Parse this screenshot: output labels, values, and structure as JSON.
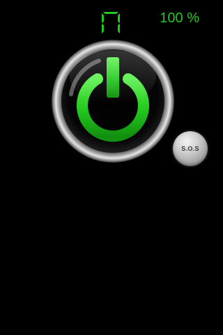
{
  "status": {
    "level_indicator": "7-segment-digit-icon",
    "battery_text": "100 %"
  },
  "power_button": {
    "icon": "power-icon",
    "state": "on",
    "color": "#22c81e"
  },
  "sos_button": {
    "label": "S.O.S"
  },
  "colors": {
    "background": "#000000",
    "accent_green": "#22c81e",
    "ring_silver": "#bdbdbd"
  }
}
